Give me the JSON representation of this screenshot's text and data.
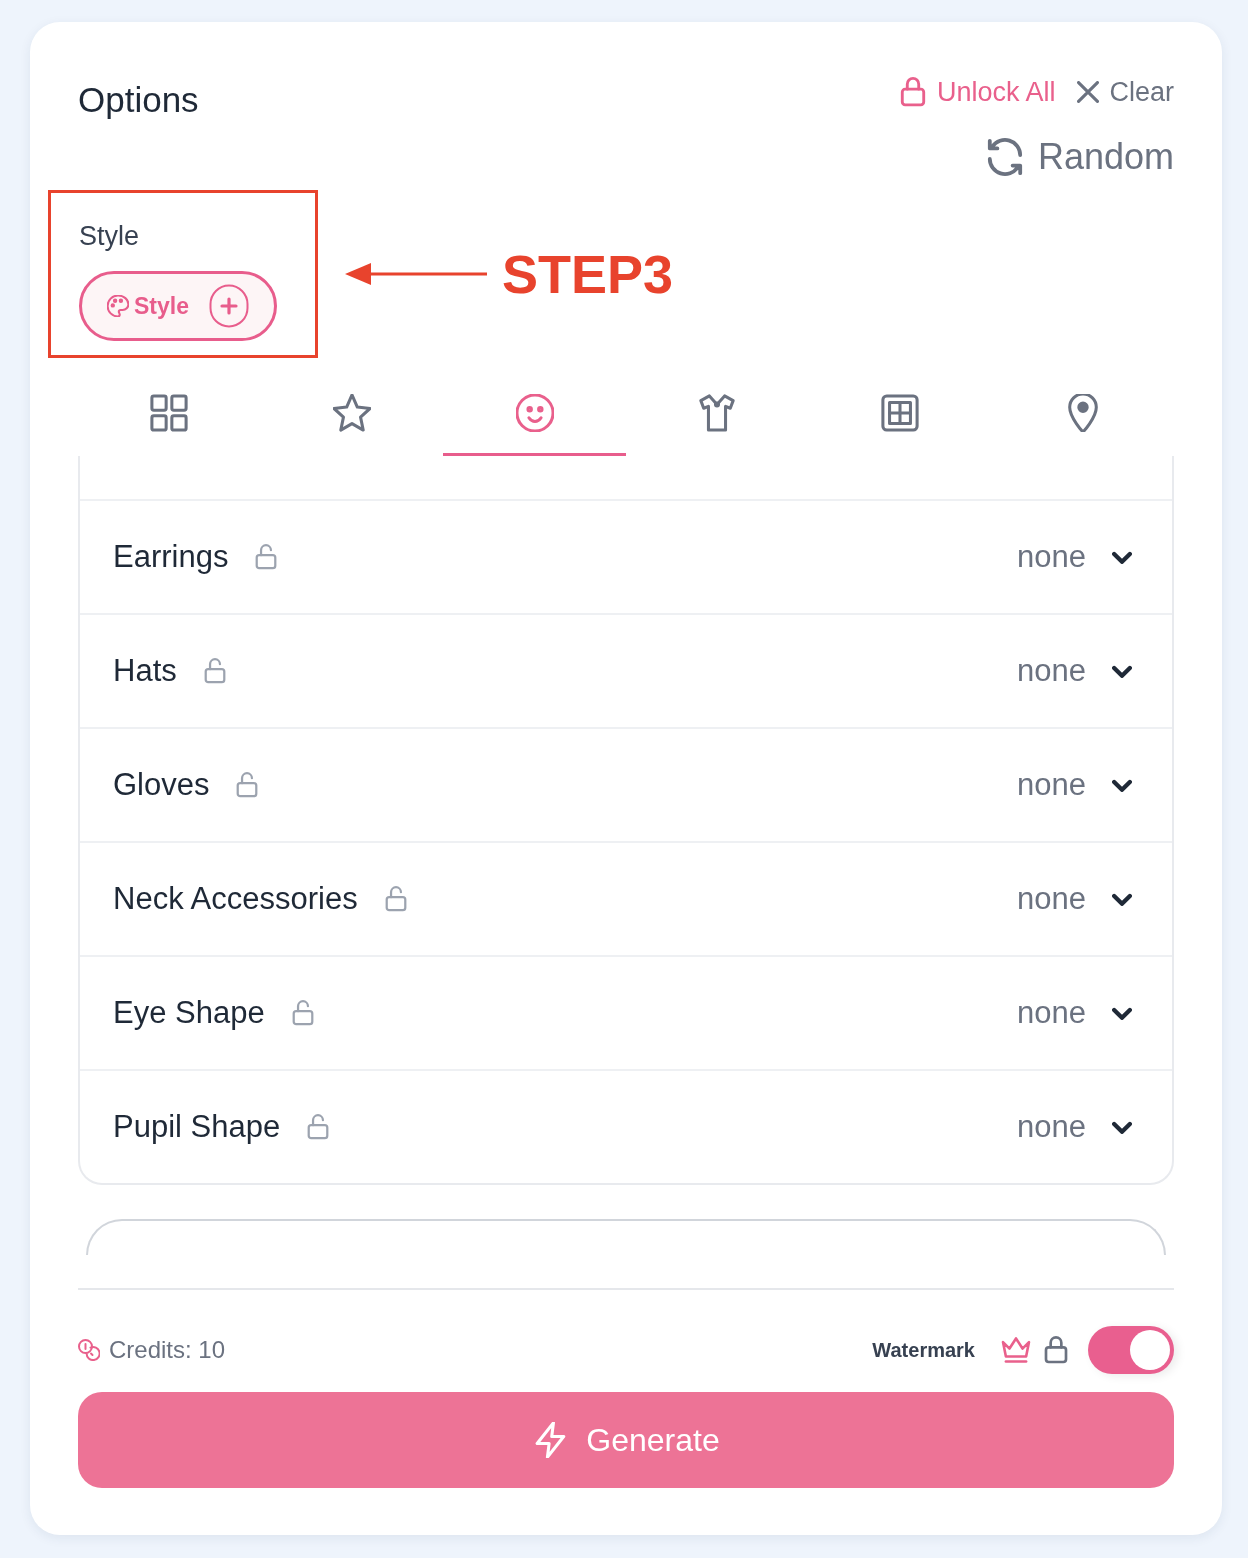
{
  "header": {
    "title": "Options",
    "unlock_all": "Unlock All",
    "clear": "Clear",
    "random": "Random"
  },
  "style_section": {
    "label": "Style",
    "button": "Style"
  },
  "annotation": {
    "label": "STEP3"
  },
  "tabs": [
    {
      "kind": "grid",
      "selected": false
    },
    {
      "kind": "star",
      "selected": false
    },
    {
      "kind": "face",
      "selected": true
    },
    {
      "kind": "shirt",
      "selected": false
    },
    {
      "kind": "frame",
      "selected": false
    },
    {
      "kind": "pin",
      "selected": false
    }
  ],
  "options": [
    {
      "label": "Earrings",
      "locked": false,
      "value": "none"
    },
    {
      "label": "Hats",
      "locked": false,
      "value": "none"
    },
    {
      "label": "Gloves",
      "locked": false,
      "value": "none"
    },
    {
      "label": "Neck Accessories",
      "locked": false,
      "value": "none"
    },
    {
      "label": "Eye Shape",
      "locked": false,
      "value": "none"
    },
    {
      "label": "Pupil Shape",
      "locked": false,
      "value": "none"
    }
  ],
  "footer": {
    "credits": "Credits: 10",
    "watermark": {
      "label": "Watermark",
      "on": true
    },
    "generate": "Generate"
  }
}
